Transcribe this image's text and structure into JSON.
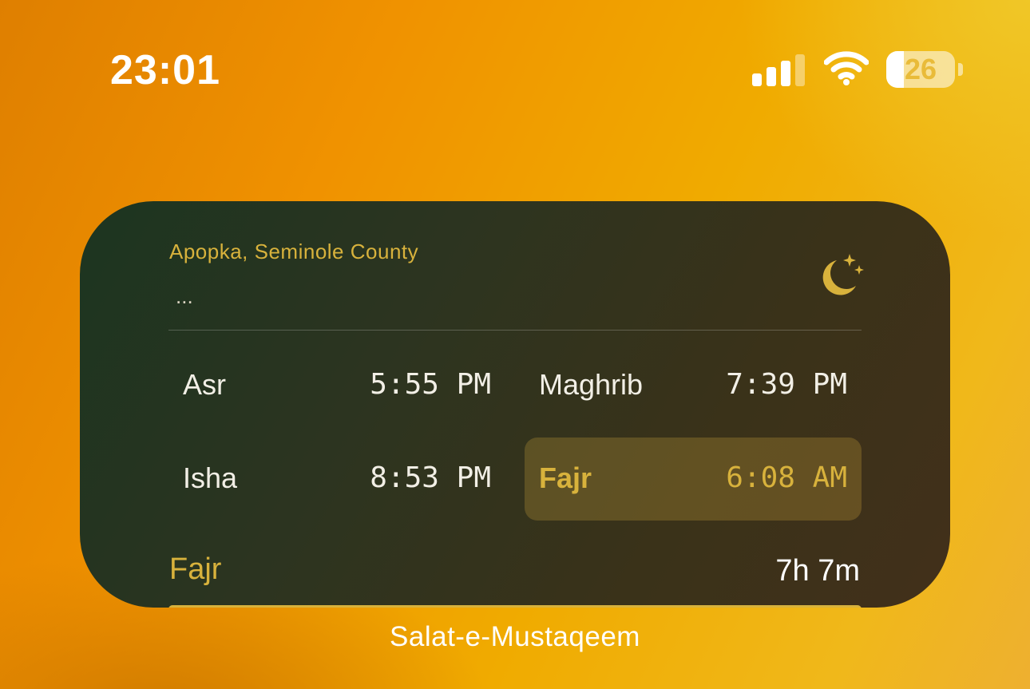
{
  "status_bar": {
    "time": "23:01",
    "signal_icon": "cellular-signal-icon",
    "wifi_icon": "wifi-icon",
    "battery_icon": "battery-icon",
    "battery_level": "26",
    "signal_bars_filled": 3,
    "signal_bars_total": 4,
    "battery_fraction": 0.26
  },
  "widget": {
    "location": "Apopka, Seminole County",
    "subtitle": "...",
    "moon_icon": "moon-stars-icon",
    "accent_color": "#d8b23c",
    "prayers": [
      {
        "name": "Asr",
        "time": "5:55 PM",
        "highlighted": false
      },
      {
        "name": "Maghrib",
        "time": "7:39 PM",
        "highlighted": false
      },
      {
        "name": "Isha",
        "time": "8:53 PM",
        "highlighted": false
      },
      {
        "name": "Fajr",
        "time": "6:08 AM",
        "highlighted": true
      }
    ],
    "next_prayer": {
      "name": "Fajr",
      "countdown": "7h 7m",
      "progress": 1.0
    }
  },
  "widget_label": "Salat-e-Mustaqeem"
}
